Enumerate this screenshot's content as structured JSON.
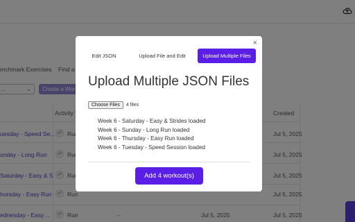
{
  "colors": {
    "accent": "#5a1ee6",
    "link": "#4a3fc4",
    "overlay": "rgba(0,0,0,0.5)"
  },
  "background": {
    "top_icon": "cloud-upload-icon",
    "tabs": [
      "enchmark Exercises",
      "Find a"
    ],
    "select_value": "...",
    "create_button": "Create a Wor",
    "headers": {
      "activity_type": "Activity T",
      "created": "Created"
    },
    "rows": [
      {
        "name": "uesday - Speed Se...",
        "type": "Run",
        "dash": "",
        "d1": "",
        "d2": "Jul 5, 2025"
      },
      {
        "name": "unday - Long Run",
        "type": "Run",
        "dash": "",
        "d1": "",
        "d2": "Jul 5, 2025"
      },
      {
        "name": "Saturday - Easy & S",
        "type": "Run",
        "dash": "",
        "d1": "",
        "d2": "Jul 5, 2025"
      },
      {
        "name": "hursday - Easy Run",
        "type": "Run",
        "dash": "",
        "d1": "",
        "d2": "Jul 5, 2025"
      },
      {
        "name": "ednesday - Easy ...",
        "type": "Run",
        "dash": "--",
        "d1": "Jul 5, 2025",
        "d2": "Jul 5, 2025"
      }
    ]
  },
  "modal": {
    "close": "×",
    "tabs": [
      {
        "label": "Edit JSON",
        "active": false
      },
      {
        "label": "Upload File and Edit",
        "active": false
      },
      {
        "label": "Upload Multiple Files",
        "active": true
      }
    ],
    "title": "Upload Multiple JSON Files",
    "choose_files_label": "Choose Files",
    "file_count": "4 files",
    "loaded_lines": [
      "Week 6 - Saturday - Easy & Strides loaded",
      "Week 6 - Sunday - Long Run loaded",
      "Week 6 - Thursday - Easy Run loaded",
      "Week 6 - Tuesday - Speed Session loaded"
    ],
    "add_button": "Add 4 workout(s)"
  }
}
